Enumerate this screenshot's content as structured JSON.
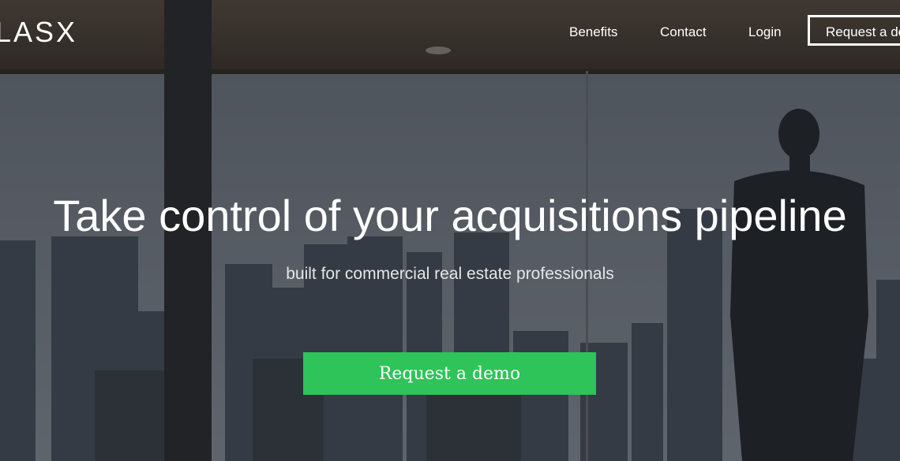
{
  "brand": {
    "logo_text": "LASX"
  },
  "nav": {
    "links": [
      "Benefits",
      "Contact",
      "Login"
    ],
    "cta_label": "Request a demo"
  },
  "hero": {
    "headline": "Take control of your acquisitions pipeline",
    "subheadline": "built for commercial real estate professionals",
    "cta_label": "Request a demo"
  },
  "colors": {
    "accent": "#2ec45a",
    "overlay": "#14181e"
  }
}
